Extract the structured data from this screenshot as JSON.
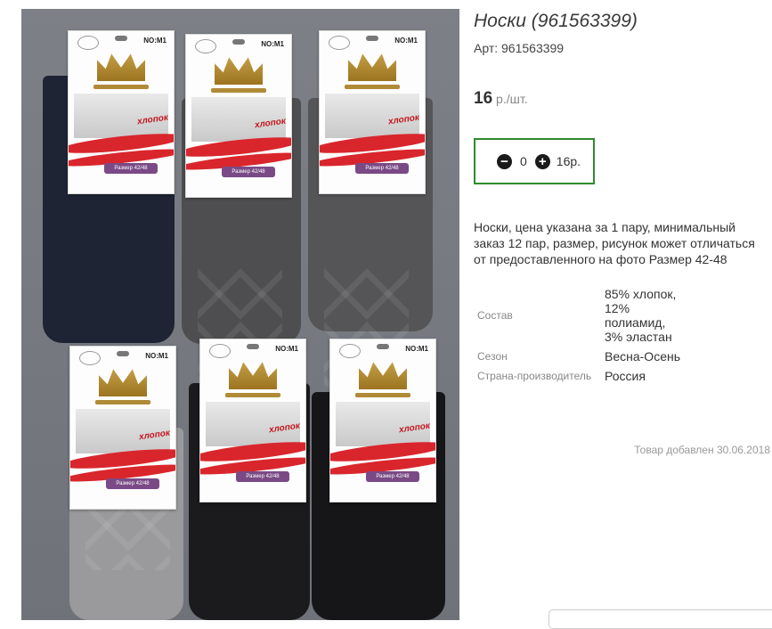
{
  "product": {
    "title": "Носки (961563399)",
    "article": "Арт: 961563399",
    "price_value": "16",
    "price_unit": " р./шт.",
    "quantity": "0",
    "total": "16р.",
    "description": "Носки, цена указана за 1 пару, минимальный заказ 12 пар, размер, рисунок может отличаться от предоставленного на фото Размер 42-48",
    "specs": [
      {
        "label": "Состав",
        "value": "85% хлопок, 12% полиамид, 3% эластан"
      },
      {
        "label": "Сезон",
        "value": "Весна-Осень"
      },
      {
        "label": "Страна-производитель",
        "value": "Россия"
      }
    ],
    "added_date": "Товар добавлен 30.06.2018"
  },
  "image": {
    "card_no": "NO:M1",
    "card_material": "хлопок",
    "card_size": "Размер 42/48",
    "sock_colors": [
      "#1e2434",
      "#4e4e50",
      "#555557",
      "#9a9a9c",
      "#1b1b1d",
      "#161618"
    ]
  },
  "icons": {
    "minus": "minus-circle-icon",
    "plus": "plus-circle-icon"
  },
  "colors": {
    "accent_border": "#2e8b2e"
  }
}
